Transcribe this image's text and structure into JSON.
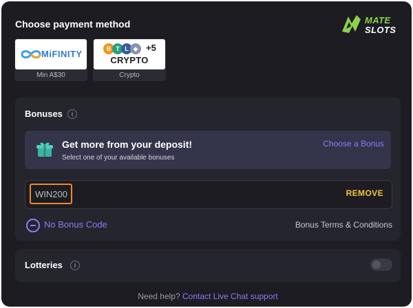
{
  "header": {
    "title": "Choose payment method"
  },
  "brand": {
    "line1": "MATE",
    "line2": "SLOTS",
    "accent": "#8bd34a"
  },
  "payment_methods": [
    {
      "logo_text": "MiFINITY",
      "caption": "Min A$30",
      "icon": "mifinity-logo"
    },
    {
      "logo_text": "CRYPTO",
      "coins": [
        "B",
        "T",
        "L"
      ],
      "extra": "+5",
      "caption": "Crypto",
      "icon": "crypto-coins-logo"
    }
  ],
  "bonuses": {
    "title": "Bonuses",
    "promo": {
      "title": "Get more from your deposit!",
      "subtitle": "Select one of your available bonuses",
      "link": "Choose a Bonus",
      "icon": "gift-icon"
    },
    "code": {
      "value": "WIN200",
      "action": "REMOVE"
    },
    "no_bonus_label": "No Bonus Code",
    "terms_link": "Bonus Terms & Conditions"
  },
  "lotteries": {
    "title": "Lotteries",
    "enabled": false
  },
  "help": {
    "prefix": "Need help?",
    "link": "Contact Live Chat support"
  },
  "colors": {
    "background": "#1c1c22",
    "section": "#25252d",
    "accent": "#8b7cf6",
    "highlight": "#f0892a",
    "remove": "#f5c33b"
  }
}
